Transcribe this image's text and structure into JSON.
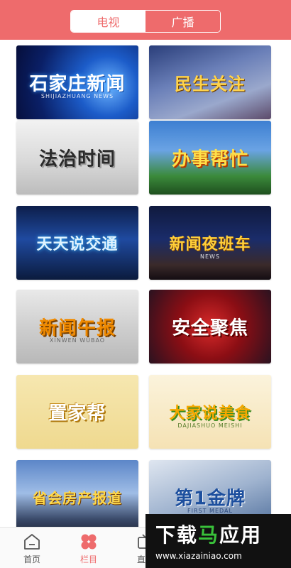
{
  "header": {
    "tabs": [
      {
        "label": "电视",
        "active": true
      },
      {
        "label": "广播",
        "active": false
      }
    ]
  },
  "programs": [
    {
      "title": "石家庄新闻",
      "subtitle": "SHIJIAZHUANG NEWS"
    },
    {
      "title": "民生关注",
      "subtitle": ""
    },
    {
      "title": "法治时间",
      "subtitle": ""
    },
    {
      "title": "办事帮忙",
      "subtitle": ""
    },
    {
      "title": "天天说交通",
      "subtitle": ""
    },
    {
      "title": "新闻夜班车",
      "subtitle": "NEWS"
    },
    {
      "title": "新闻午报",
      "subtitle": "XINWEN WUBAO"
    },
    {
      "title": "安全聚焦",
      "subtitle": ""
    },
    {
      "title": "置家帮",
      "subtitle": ""
    },
    {
      "title": "大家说美食",
      "subtitle": "DAJIASHUO MEISHI"
    },
    {
      "title": "省会房产报道",
      "subtitle": ""
    },
    {
      "title": "第1金牌",
      "subtitle": "FIRST MEDAL"
    }
  ],
  "tabbar": {
    "items": [
      {
        "label": "首页",
        "icon": "home-icon",
        "active": false
      },
      {
        "label": "栏目",
        "icon": "clover-icon",
        "active": true
      },
      {
        "label": "直播",
        "icon": "live-icon",
        "active": false
      }
    ]
  },
  "watermark": {
    "title_part1": "下载",
    "title_part2": "马",
    "title_part3": "应用",
    "url": "www.xiazainiao.com"
  },
  "colors": {
    "accent": "#ee6b6c",
    "watermark_green": "#39c13a"
  }
}
